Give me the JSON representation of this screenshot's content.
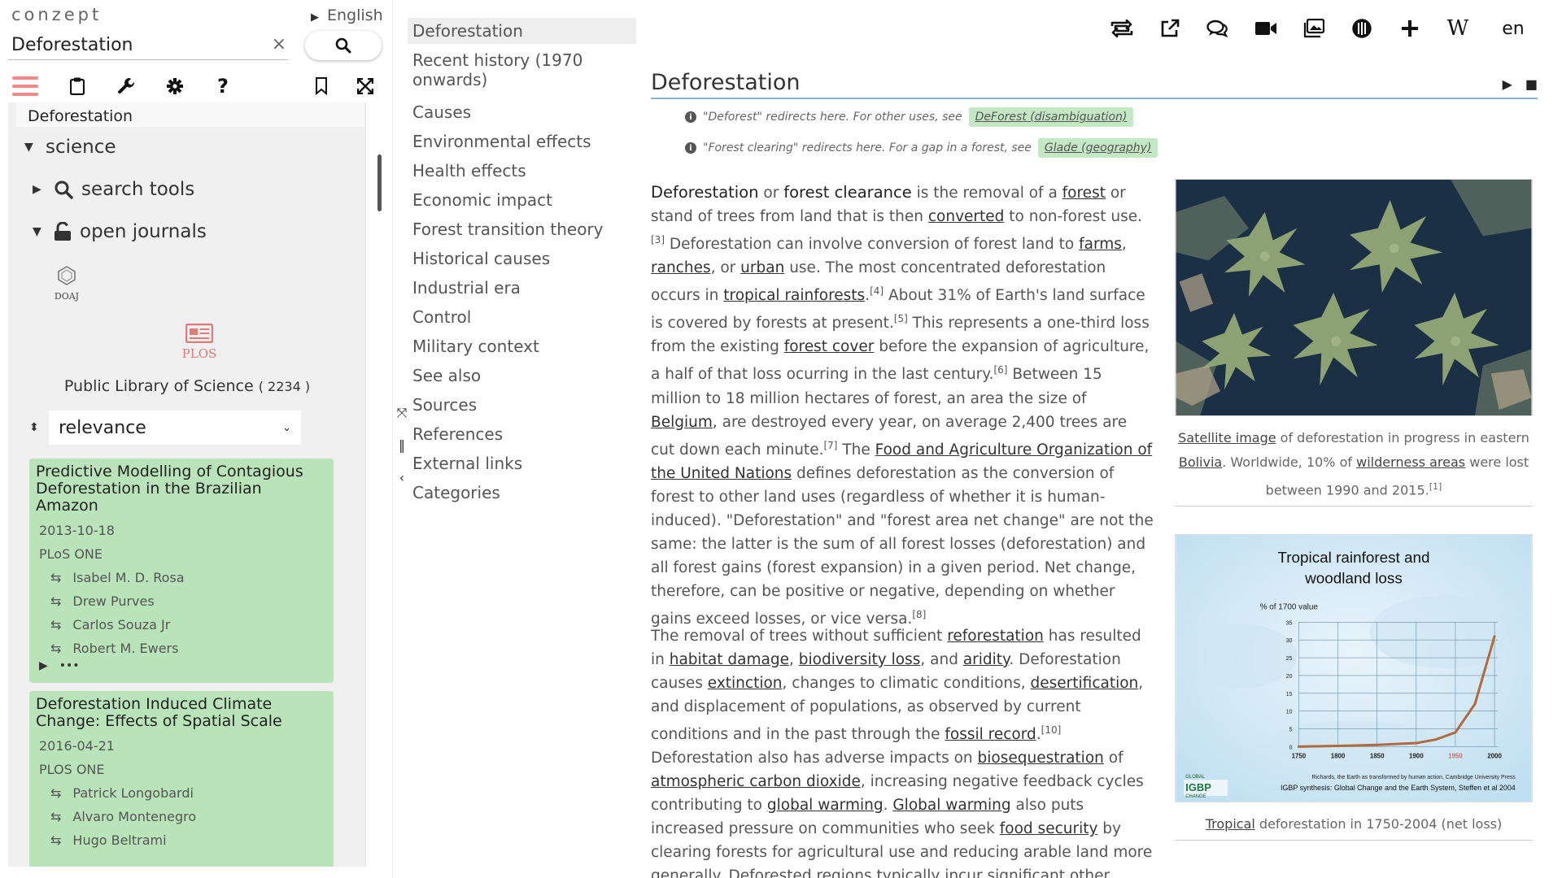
{
  "left": {
    "brand": "conzept",
    "language": "English",
    "search": {
      "value": "Deforestation",
      "clear": "×"
    },
    "tree": {
      "title": "Deforestation",
      "science": "science",
      "search_tools": "search tools",
      "open_journals": "open journals",
      "doaj": "DOAJ",
      "plos": "PLOS",
      "plos_name": "Public Library of Science",
      "plos_count": "( 2234 )"
    },
    "sort": {
      "value": "relevance"
    },
    "cards": [
      {
        "title": "Predictive Modelling of Contagious Deforestation in the Brazilian Amazon",
        "date": "2013-10-18",
        "journal": "PLoS ONE",
        "authors": [
          "Isabel M. D. Rosa",
          "Drew Purves",
          "Carlos Souza Jr",
          "Robert M. Ewers"
        ],
        "more": "•••"
      },
      {
        "title": "Deforestation Induced Climate Change: Effects of Spatial Scale",
        "date": "2016-04-21",
        "journal": "PLOS ONE",
        "authors": [
          "Patrick Longobardi",
          "Alvaro Montenegro",
          "Hugo Beltrami"
        ]
      }
    ]
  },
  "toc": {
    "items": [
      "Deforestation",
      "Recent history (1970 onwards)",
      "Causes",
      "Environmental effects",
      "Health effects",
      "Economic impact",
      "Forest transition theory",
      "Historical causes",
      "Industrial era",
      "Control",
      "Military context",
      "See also",
      "Sources",
      "References",
      "External links",
      "Categories"
    ]
  },
  "article": {
    "lang": "en",
    "wiki_icon": "W",
    "title": "Deforestation",
    "hatnotes": [
      {
        "text": "\"Deforest\" redirects here. For other uses, see",
        "link": "DeForest (disambiguation)"
      },
      {
        "text": "\"Forest clearing\" redirects here. For a gap in a forest, see",
        "link": "Glade (geography)"
      }
    ],
    "fig1_caption": {
      "link1": "Satellite image",
      "t1": " of deforestation in progress in eastern ",
      "link2": "Bolivia",
      "t2": ". Worldwide, 10% of ",
      "link3": "wilderness areas",
      "t3": " were lost between 1990 and 2015.",
      "ref": "[1]"
    },
    "fig2": {
      "title_line1": "Tropical rainforest and",
      "title_line2": "woodland loss",
      "ylabel": "% of 1700 value",
      "source_line1": "Richards, the Earth as transformed by human action, Cambridge University Press",
      "source_line2": "IGBP synthesis: Global Change and the Earth System, Steffen et al 2004",
      "igbp": "IGBP",
      "global": "GLOBAL",
      "change": "CHANGE",
      "caption_link": "Tropical",
      "caption_rest": " deforestation in 1750-2004 (net loss)"
    },
    "chart_data": {
      "type": "line",
      "title": "Tropical rainforest and woodland loss",
      "ylabel": "% of 1700 value",
      "x": [
        1750,
        1800,
        1850,
        1900,
        1925,
        1950,
        1975,
        2000
      ],
      "y": [
        0,
        0.2,
        0.5,
        1,
        2,
        4,
        12,
        31
      ],
      "xticks": [
        1750,
        1800,
        1850,
        1900,
        1950,
        2000
      ],
      "yticks": [
        0,
        5,
        10,
        15,
        20,
        25,
        30,
        35
      ],
      "ylim": [
        0,
        35
      ],
      "xlim": [
        1750,
        2004
      ],
      "line_color": "#b06a3b"
    }
  }
}
